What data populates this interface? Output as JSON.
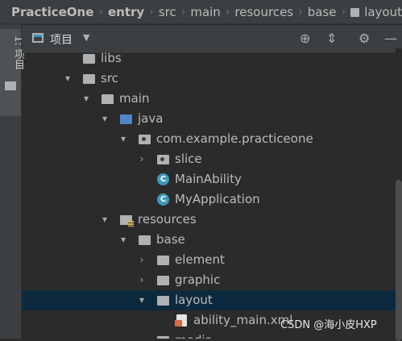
{
  "breadcrumb": {
    "items": [
      "PracticeOne",
      "entry",
      "src",
      "main",
      "resources",
      "base",
      "layout"
    ]
  },
  "side_tab": {
    "label": "1: 项目"
  },
  "panel": {
    "title": "项目"
  },
  "tree": [
    {
      "label": "libs",
      "arrow": "",
      "icon": "folder"
    },
    {
      "label": "src",
      "arrow": "▾",
      "icon": "folder"
    },
    {
      "label": "main",
      "arrow": "▾",
      "icon": "folder"
    },
    {
      "label": "java",
      "arrow": "▾",
      "icon": "source-folder"
    },
    {
      "label": "com.example.practiceone",
      "arrow": "▾",
      "icon": "package"
    },
    {
      "label": "slice",
      "arrow": "›",
      "icon": "package"
    },
    {
      "label": "MainAbility",
      "arrow": "",
      "icon": "class"
    },
    {
      "label": "MyApplication",
      "arrow": "",
      "icon": "class"
    },
    {
      "label": "resources",
      "arrow": "▾",
      "icon": "resources-folder"
    },
    {
      "label": "base",
      "arrow": "▾",
      "icon": "folder"
    },
    {
      "label": "element",
      "arrow": "›",
      "icon": "folder"
    },
    {
      "label": "graphic",
      "arrow": "›",
      "icon": "folder"
    },
    {
      "label": "layout",
      "arrow": "▾",
      "icon": "folder",
      "selected": true
    },
    {
      "label": "ability_main.xml",
      "arrow": "",
      "icon": "xml-file"
    },
    {
      "label": "media",
      "arrow": "›",
      "icon": "folder"
    }
  ],
  "watermark": "CSDN @海小皮HXP",
  "colors": {
    "selection": "#0d293e",
    "background": "#2b2b2b",
    "header": "#3c3f41"
  }
}
